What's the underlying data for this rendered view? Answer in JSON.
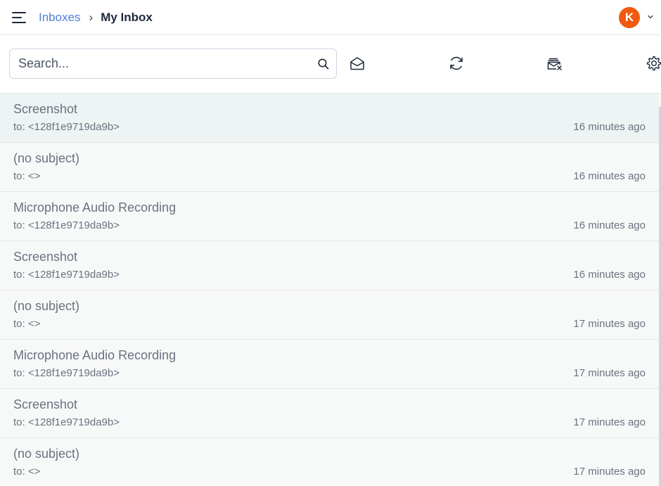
{
  "header": {
    "breadcrumb": {
      "parent": "Inboxes",
      "separator": "›",
      "current": "My Inbox"
    },
    "avatar_initial": "K",
    "avatar_color": "#f05a10"
  },
  "toolbar": {
    "search_placeholder": "Search...",
    "search_value": ""
  },
  "messages": [
    {
      "subject": "Screenshot",
      "to": "to: <128f1e9719da9b>",
      "time": "16 minutes ago",
      "selected": true
    },
    {
      "subject": "(no subject)",
      "to": "to: <>",
      "time": "16 minutes ago"
    },
    {
      "subject": "Microphone Audio Recording",
      "to": "to: <128f1e9719da9b>",
      "time": "16 minutes ago"
    },
    {
      "subject": "Screenshot",
      "to": "to: <128f1e9719da9b>",
      "time": "16 minutes ago"
    },
    {
      "subject": "(no subject)",
      "to": "to: <>",
      "time": "17 minutes ago"
    },
    {
      "subject": "Microphone Audio Recording",
      "to": "to: <128f1e9719da9b>",
      "time": "17 minutes ago"
    },
    {
      "subject": "Screenshot",
      "to": "to: <128f1e9719da9b>",
      "time": "17 minutes ago"
    },
    {
      "subject": "(no subject)",
      "to": "to: <>",
      "time": "17 minutes ago"
    }
  ],
  "colors": {
    "link": "#4f7fd6",
    "selected_row": "#eef3f3",
    "row_bg": "#f7f8f8"
  }
}
